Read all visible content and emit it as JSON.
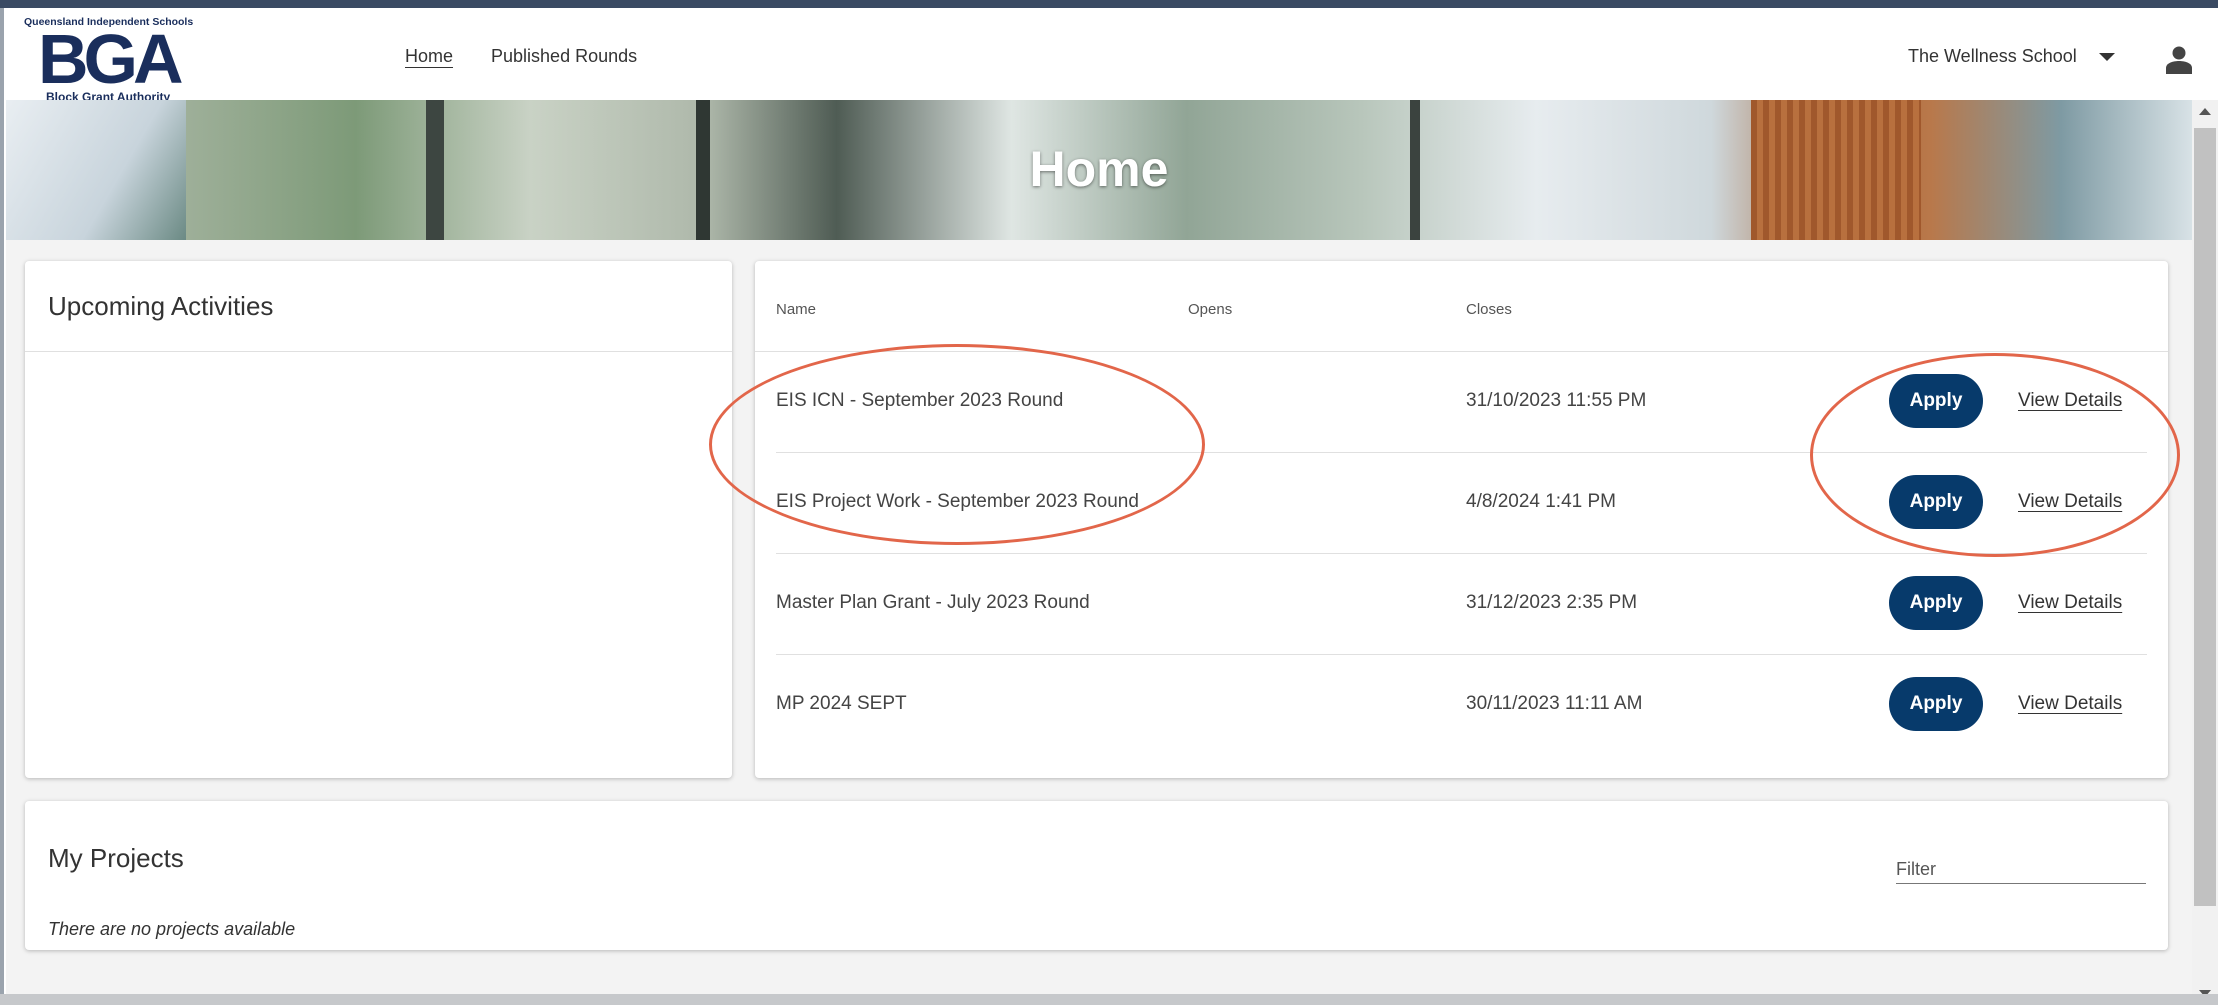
{
  "header": {
    "logo": {
      "top_text": "Queensland Independent Schools",
      "letters": "BGA",
      "bottom_text": "Block Grant Authority"
    },
    "nav": [
      {
        "label": "Home",
        "active": true
      },
      {
        "label": "Published Rounds",
        "active": false
      }
    ],
    "school_selector": {
      "value": "The Wellness School",
      "icon": "caret-down-icon"
    },
    "user_icon": "user-icon"
  },
  "banner": {
    "title": "Home"
  },
  "upcoming": {
    "title": "Upcoming Activities"
  },
  "rounds": {
    "columns": {
      "name": "Name",
      "opens": "Opens",
      "closes": "Closes"
    },
    "rows": [
      {
        "name": "EIS ICN - September 2023 Round",
        "opens": "",
        "closes": "31/10/2023 11:55 PM",
        "apply": "Apply",
        "details": "View Details"
      },
      {
        "name": "EIS Project Work - September 2023 Round",
        "opens": "",
        "closes": "4/8/2024 1:41 PM",
        "apply": "Apply",
        "details": "View Details"
      },
      {
        "name": "Master Plan Grant - July 2023 Round",
        "opens": "",
        "closes": "31/12/2023 2:35 PM",
        "apply": "Apply",
        "details": "View Details"
      },
      {
        "name": "MP 2024 SEPT",
        "opens": "",
        "closes": "30/11/2023 11:11 AM",
        "apply": "Apply",
        "details": "View Details"
      }
    ]
  },
  "projects": {
    "title": "My Projects",
    "filter_placeholder": "Filter",
    "empty_message": "There are no projects available"
  },
  "colors": {
    "primary_button": "#073a6b",
    "annotation": "#e2664a",
    "logo": "#1a2e5c"
  }
}
